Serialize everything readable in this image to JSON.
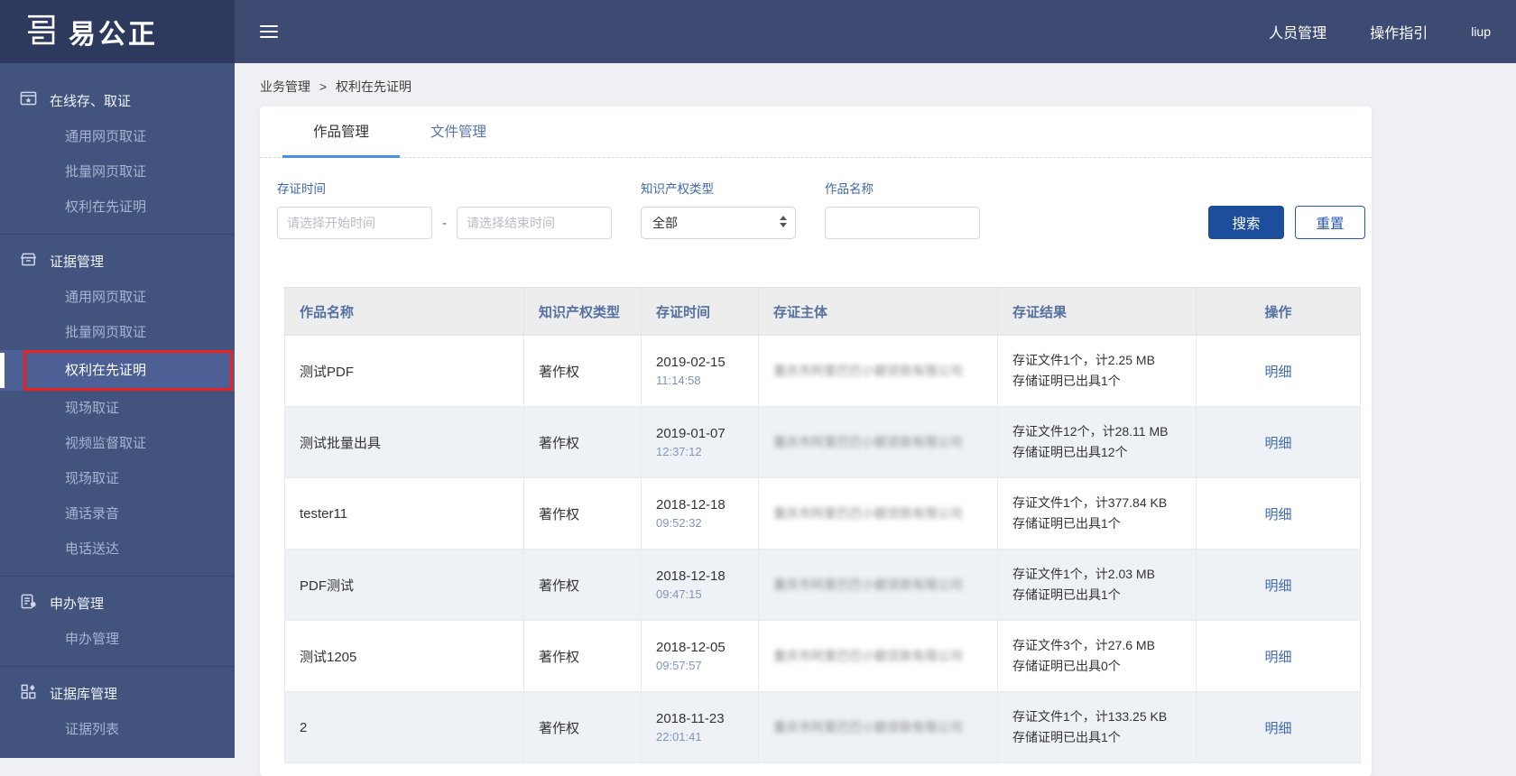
{
  "brand": {
    "logo_text": "易公正"
  },
  "topbar": {
    "links": [
      {
        "label": "人员管理"
      },
      {
        "label": "操作指引"
      }
    ],
    "user": "liup"
  },
  "sidebar": {
    "sections": [
      {
        "label": "在线存、取证",
        "icon": "window-star-icon",
        "items": [
          {
            "label": "通用网页取证"
          },
          {
            "label": "批量网页取证"
          },
          {
            "label": "权利在先证明"
          }
        ]
      },
      {
        "label": "证据管理",
        "icon": "archive-box-icon",
        "items": [
          {
            "label": "通用网页取证"
          },
          {
            "label": "批量网页取证"
          },
          {
            "label": "权利在先证明",
            "active": true,
            "annotated": true
          },
          {
            "label": "现场取证"
          },
          {
            "label": "视频监督取证"
          },
          {
            "label": "现场取证"
          },
          {
            "label": "通话录音"
          },
          {
            "label": "电话送达"
          }
        ]
      },
      {
        "label": "申办管理",
        "icon": "document-icon",
        "items": [
          {
            "label": "申办管理"
          }
        ]
      },
      {
        "label": "证据库管理",
        "icon": "grid-icon",
        "items": [
          {
            "label": "证据列表"
          }
        ]
      }
    ]
  },
  "breadcrumb": {
    "section": "业务管理",
    "separator": ">",
    "current": "权利在先证明"
  },
  "tabs": [
    {
      "label": "作品管理",
      "active": true
    },
    {
      "label": "文件管理",
      "active": false
    }
  ],
  "filters": {
    "time_label": "存证时间",
    "start_placeholder": "请选择开始时间",
    "end_placeholder": "请选择结束时间",
    "range_separator": "-",
    "type_label": "知识产权类型",
    "type_value": "全部",
    "name_label": "作品名称",
    "name_value": "",
    "search_label": "搜索",
    "reset_label": "重置"
  },
  "table": {
    "columns": [
      "作品名称",
      "知识产权类型",
      "存证时间",
      "存证主体",
      "存证结果",
      "操作"
    ],
    "action_label": "明细",
    "subject_note": "blurred-company-name",
    "rows": [
      {
        "name": "测试PDF",
        "type": "著作权",
        "date": "2019-02-15",
        "time": "11:14:58",
        "subject": "重庆市阿里巴巴小额贷款有限公司",
        "result_line1": "存证文件1个，计2.25 MB",
        "result_line2": "存储证明已出具1个"
      },
      {
        "name": "测试批量出具",
        "type": "著作权",
        "date": "2019-01-07",
        "time": "12:37:12",
        "subject": "重庆市阿里巴巴小额贷款有限公司",
        "result_line1": "存证文件12个，计28.11 MB",
        "result_line2": "存储证明已出具12个"
      },
      {
        "name": "tester11",
        "type": "著作权",
        "date": "2018-12-18",
        "time": "09:52:32",
        "subject": "重庆市阿里巴巴小额贷款有限公司",
        "result_line1": "存证文件1个，计377.84 KB",
        "result_line2": "存储证明已出具1个"
      },
      {
        "name": "PDF测试",
        "type": "著作权",
        "date": "2018-12-18",
        "time": "09:47:15",
        "subject": "重庆市阿里巴巴小额贷款有限公司",
        "result_line1": "存证文件1个，计2.03 MB",
        "result_line2": "存储证明已出具1个"
      },
      {
        "name": "测试1205",
        "type": "著作权",
        "date": "2018-12-05",
        "time": "09:57:57",
        "subject": "重庆市阿里巴巴小额贷款有限公司",
        "result_line1": "存证文件3个，计27.6 MB",
        "result_line2": "存储证明已出具0个"
      },
      {
        "name": "2",
        "type": "著作权",
        "date": "2018-11-23",
        "time": "22:01:41",
        "subject": "重庆市阿里巴巴小额贷款有限公司",
        "result_line1": "存证文件1个，计133.25 KB",
        "result_line2": "存储证明已出具1个"
      }
    ]
  },
  "colors": {
    "logo_bg": "#2d3a5e",
    "topbar_bg": "#3d4b73",
    "sidebar_bg": "#42547d",
    "active_item_bg": "#4c6095",
    "annotation_red": "#e8231d",
    "tab_underline": "#4a90e2",
    "primary_button": "#1d4e9d",
    "link_blue": "#3f69ad",
    "header_text": "#54719f",
    "zebra_row": "#eef2f7"
  }
}
